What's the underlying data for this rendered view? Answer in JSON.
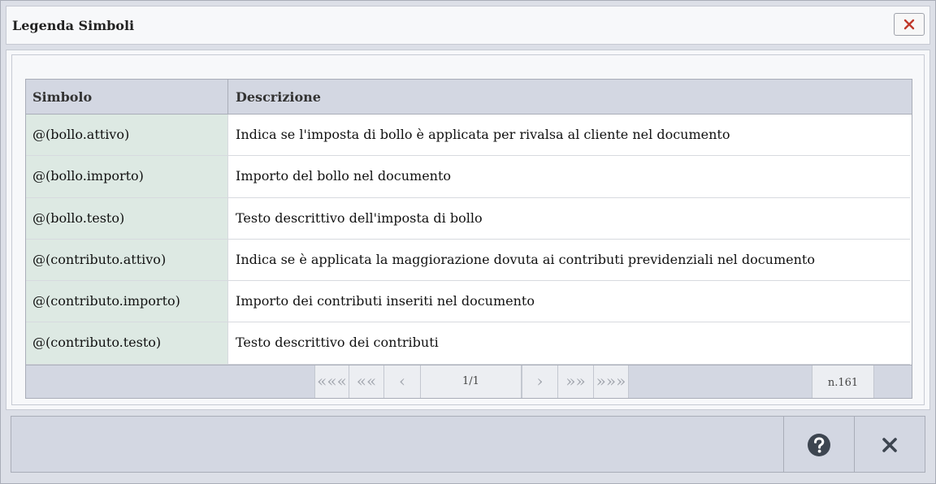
{
  "window": {
    "title": "Legenda Simboli"
  },
  "table": {
    "columns": [
      "Simbolo",
      "Descrizione"
    ],
    "rows": [
      {
        "symbol": "@(bollo.attivo)",
        "description": "Indica se l'imposta di bollo è applicata per rivalsa al cliente nel documento"
      },
      {
        "symbol": "@(bollo.importo)",
        "description": "Importo del bollo nel documento"
      },
      {
        "symbol": "@(bollo.testo)",
        "description": "Testo descrittivo dell'imposta di bollo"
      },
      {
        "symbol": "@(contributo.attivo)",
        "description": "Indica se è applicata la maggiorazione dovuta ai contributi previdenziali nel documento"
      },
      {
        "symbol": "@(contributo.importo)",
        "description": "Importo dei contributi inseriti nel documento"
      },
      {
        "symbol": "@(contributo.testo)",
        "description": "Testo descrittivo dei contributi"
      }
    ]
  },
  "pager": {
    "first_label": "«««",
    "fast_back_label": "««",
    "prev_label": "‹",
    "page_info": "1/1",
    "next_label": "›",
    "fast_forward_label": "»»",
    "last_label": "»»»",
    "record_count": "n.161"
  },
  "icons": {
    "close": "close-icon",
    "help": "help-icon",
    "footer_close": "close-icon"
  },
  "colors": {
    "accent_close": "#c0392b",
    "footer_icon": "#3d4550",
    "symbol_column_bg": "#dde9e3",
    "header_bg": "#d3d7e2"
  }
}
